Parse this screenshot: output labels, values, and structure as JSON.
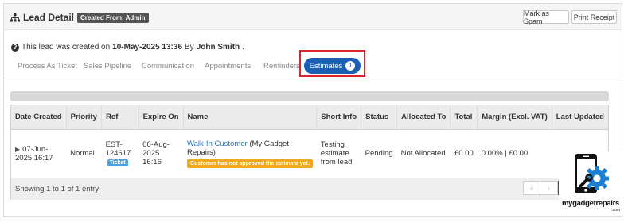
{
  "header": {
    "title": "Lead Detail",
    "created_badge": "Created From: Admin",
    "mark_spam_label": "Mark as Spam",
    "print_receipt_label": "Print Receipt"
  },
  "info": {
    "prefix": "This lead was created on",
    "date": "10-May-2025 13:36",
    "by": "By",
    "user": "John Smith",
    "suffix": "."
  },
  "tabs": [
    {
      "label": "Process As Ticket"
    },
    {
      "label": "Sales Pipeline"
    },
    {
      "label": "Communication"
    },
    {
      "label": "Appointments"
    },
    {
      "label": "Reminders"
    }
  ],
  "active_tab": {
    "label": "Estimates",
    "count": "1"
  },
  "table": {
    "headers": [
      "Date Created",
      "Priority",
      "Ref",
      "Expire On",
      "Name",
      "Short Info",
      "Status",
      "Allocated To",
      "Total",
      "Margin (Excl. VAT)",
      "Last Updated"
    ],
    "rows": [
      {
        "date_created": "07-Jun-2025 16:17",
        "priority": "Normal",
        "ref": "EST-124617",
        "ref_badge": "Ticket",
        "expire_on": "06-Aug-2025 16:16",
        "name_link": "Walk-In Customer",
        "name_extra": "(My Gadget Repairs)",
        "name_warning": "Customer has not approved the estimate yet.",
        "short_info": "Testing estimate from lead",
        "status": "Pending",
        "allocated_to": "Not Allocated",
        "total": "£0.00",
        "margin": "0.00% | £0.00",
        "last_updated": ""
      }
    ]
  },
  "footer": {
    "showing": "Showing 1 to 1 of 1 entry",
    "prev_first": "«",
    "prev": "‹"
  },
  "logo": {
    "text": "mygadgetrepairs",
    "sub": ".com"
  },
  "colors": {
    "accent": "#1a5fb4",
    "warning": "#f0a81c",
    "highlight": "#d9262b",
    "ticket": "#4aa3df"
  }
}
